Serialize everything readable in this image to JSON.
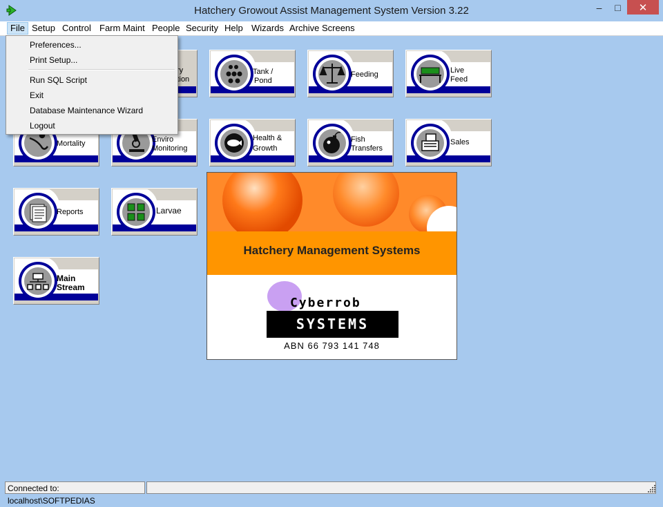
{
  "window": {
    "title": "Hatchery Growout Assist Management System Version 3.22",
    "icons": {
      "app": "green-arrow-icon",
      "minimize": "minimize-icon",
      "maximize": "maximize-icon",
      "close": "close-icon"
    },
    "minimize_glyph": "–",
    "maximize_glyph": "□",
    "close_glyph": "✕"
  },
  "menu": {
    "items": [
      "File",
      "Setup",
      "Control",
      "Farm Maint",
      "People",
      "Security",
      "Help",
      "Wizards",
      "Archive Screens"
    ],
    "active": "File"
  },
  "file_menu": {
    "items": [
      "Preferences...",
      "Print Setup...",
      "Run SQL Script",
      "Exit",
      "Database Maintenance Wizard",
      "Logout"
    ]
  },
  "tiles": {
    "tank_pond": {
      "l1": "Tank  /",
      "l2": "Pond",
      "icon": "tank-pond-icon"
    },
    "feeding": {
      "label": "Feeding",
      "icon": "scales-icon"
    },
    "live_feed": {
      "l1": "Live",
      "l2": "Feed",
      "icon": "live-feed-icon"
    },
    "hidden_tile": {
      "l1": "ry",
      "l2": "ition"
    },
    "mortality": {
      "label": "Mortality",
      "icon": "mortality-icon"
    },
    "enviro": {
      "l1": "Enviro",
      "l2": "Monitoring",
      "icon": "microscope-icon"
    },
    "health": {
      "l1": "Health &",
      "l2": "Growth",
      "icon": "fish-icon"
    },
    "fish_transfers": {
      "l1": "Fish",
      "l2": "Transfers",
      "icon": "bomb-icon"
    },
    "sales": {
      "label": "Sales",
      "icon": "cash-register-icon"
    },
    "reports": {
      "label": "Reports",
      "icon": "reports-icon"
    },
    "larvae": {
      "label": "Larvae",
      "icon": "larvae-icon"
    },
    "main_stream": {
      "l1": "Main",
      "l2": "Stream",
      "icon": "flowchart-icon"
    }
  },
  "splash": {
    "heading": "Hatchery Management Systems",
    "company": "Cyberrob",
    "systems": "SYSTEMS",
    "abn": "ABN 66 793 141 748"
  },
  "status": {
    "connection": "Connected to: localhost\\SOFTPEDIAS"
  },
  "colors": {
    "desktop": "#a7c9ee",
    "tile_blue": "#000099",
    "splash_orange": "#ff8c00"
  }
}
